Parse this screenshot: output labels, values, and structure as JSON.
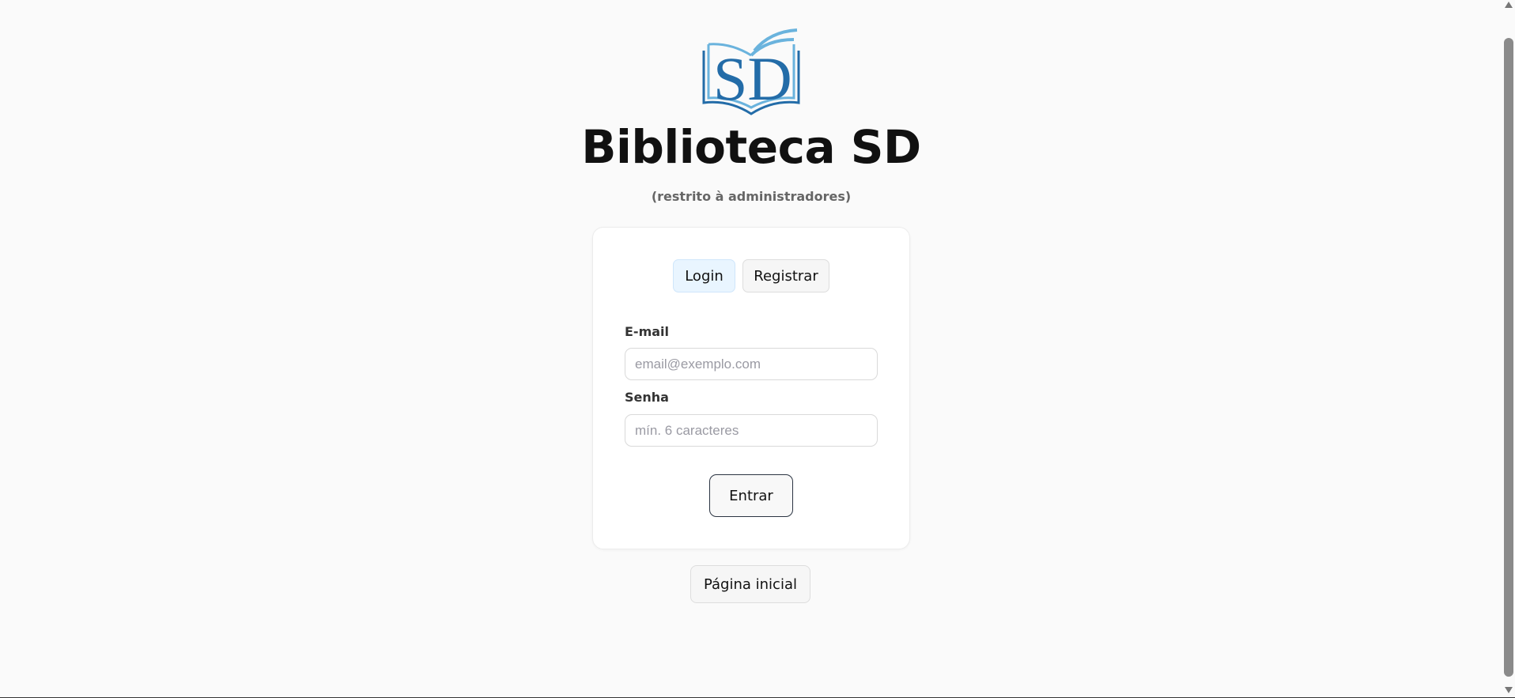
{
  "brand": {
    "logo_text": "SD",
    "title": "Biblioteca SD",
    "subtitle": "(restrito à administradores)",
    "logo_colors": {
      "dark": "#236ca8",
      "light": "#6ab3dd"
    }
  },
  "auth_tabs": [
    {
      "label": "Login",
      "active": true
    },
    {
      "label": "Registrar",
      "active": false
    }
  ],
  "form": {
    "email_label": "E-mail",
    "email_value": "",
    "email_placeholder": "email@exemplo.com",
    "password_label": "Senha",
    "password_value": "",
    "password_placeholder": "mín. 6 caracteres",
    "submit_label": "Entrar"
  },
  "home_button_label": "Página inicial"
}
